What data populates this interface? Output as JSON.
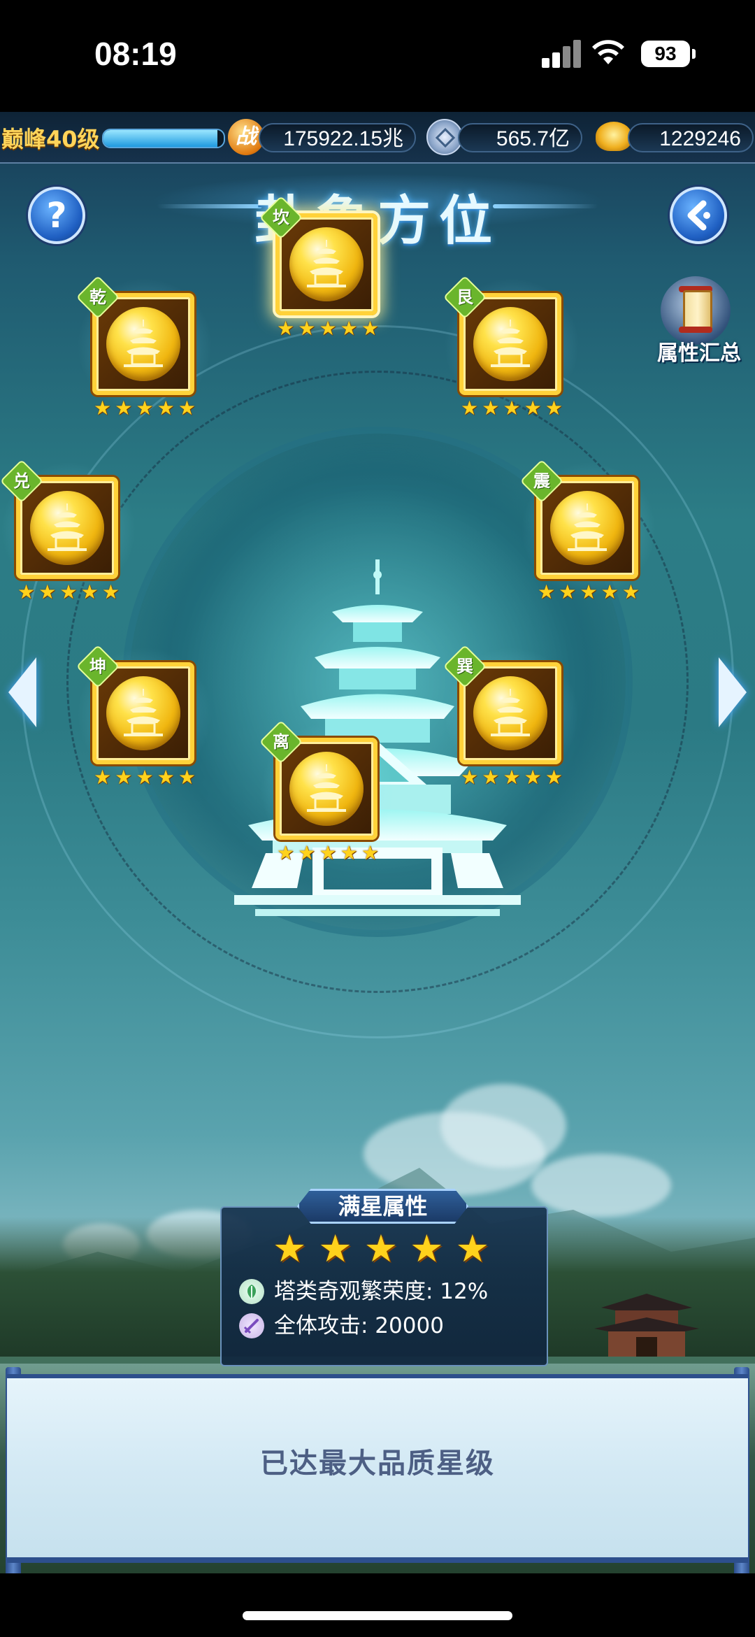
{
  "status_bar": {
    "time": "08:19",
    "battery": "93"
  },
  "top_bar": {
    "level": "巅峰40级",
    "level_progress": 0.95,
    "power_badge": "战",
    "power_value": "175922.15兆",
    "silver_value": "565.7亿",
    "gold_value": "1229246"
  },
  "header": {
    "title": "卦象方位",
    "help_label": "?",
    "back_label": "<"
  },
  "summary": {
    "label": "属性汇总"
  },
  "slots": [
    {
      "name": "坎",
      "stars": "★★★★★"
    },
    {
      "name": "艮",
      "stars": "★★★★★"
    },
    {
      "name": "震",
      "stars": "★★★★★"
    },
    {
      "name": "巽",
      "stars": "★★★★★"
    },
    {
      "name": "离",
      "stars": "★★★★★"
    },
    {
      "name": "坤",
      "stars": "★★★★★"
    },
    {
      "name": "兑",
      "stars": "★★★★★"
    },
    {
      "name": "乾",
      "stars": "★★★★★"
    }
  ],
  "selected_slot": "坎",
  "full_star": {
    "title": "满星属性",
    "stars": 5,
    "attr1": "塔类奇观繁荣度: 12%",
    "attr2": "全体攻击: 20000"
  },
  "bottom": {
    "message": "已达最大品质星级"
  },
  "colors": {
    "star": "#ffd21c",
    "frame": "#ffd23a",
    "tag": "#6ab52c"
  }
}
